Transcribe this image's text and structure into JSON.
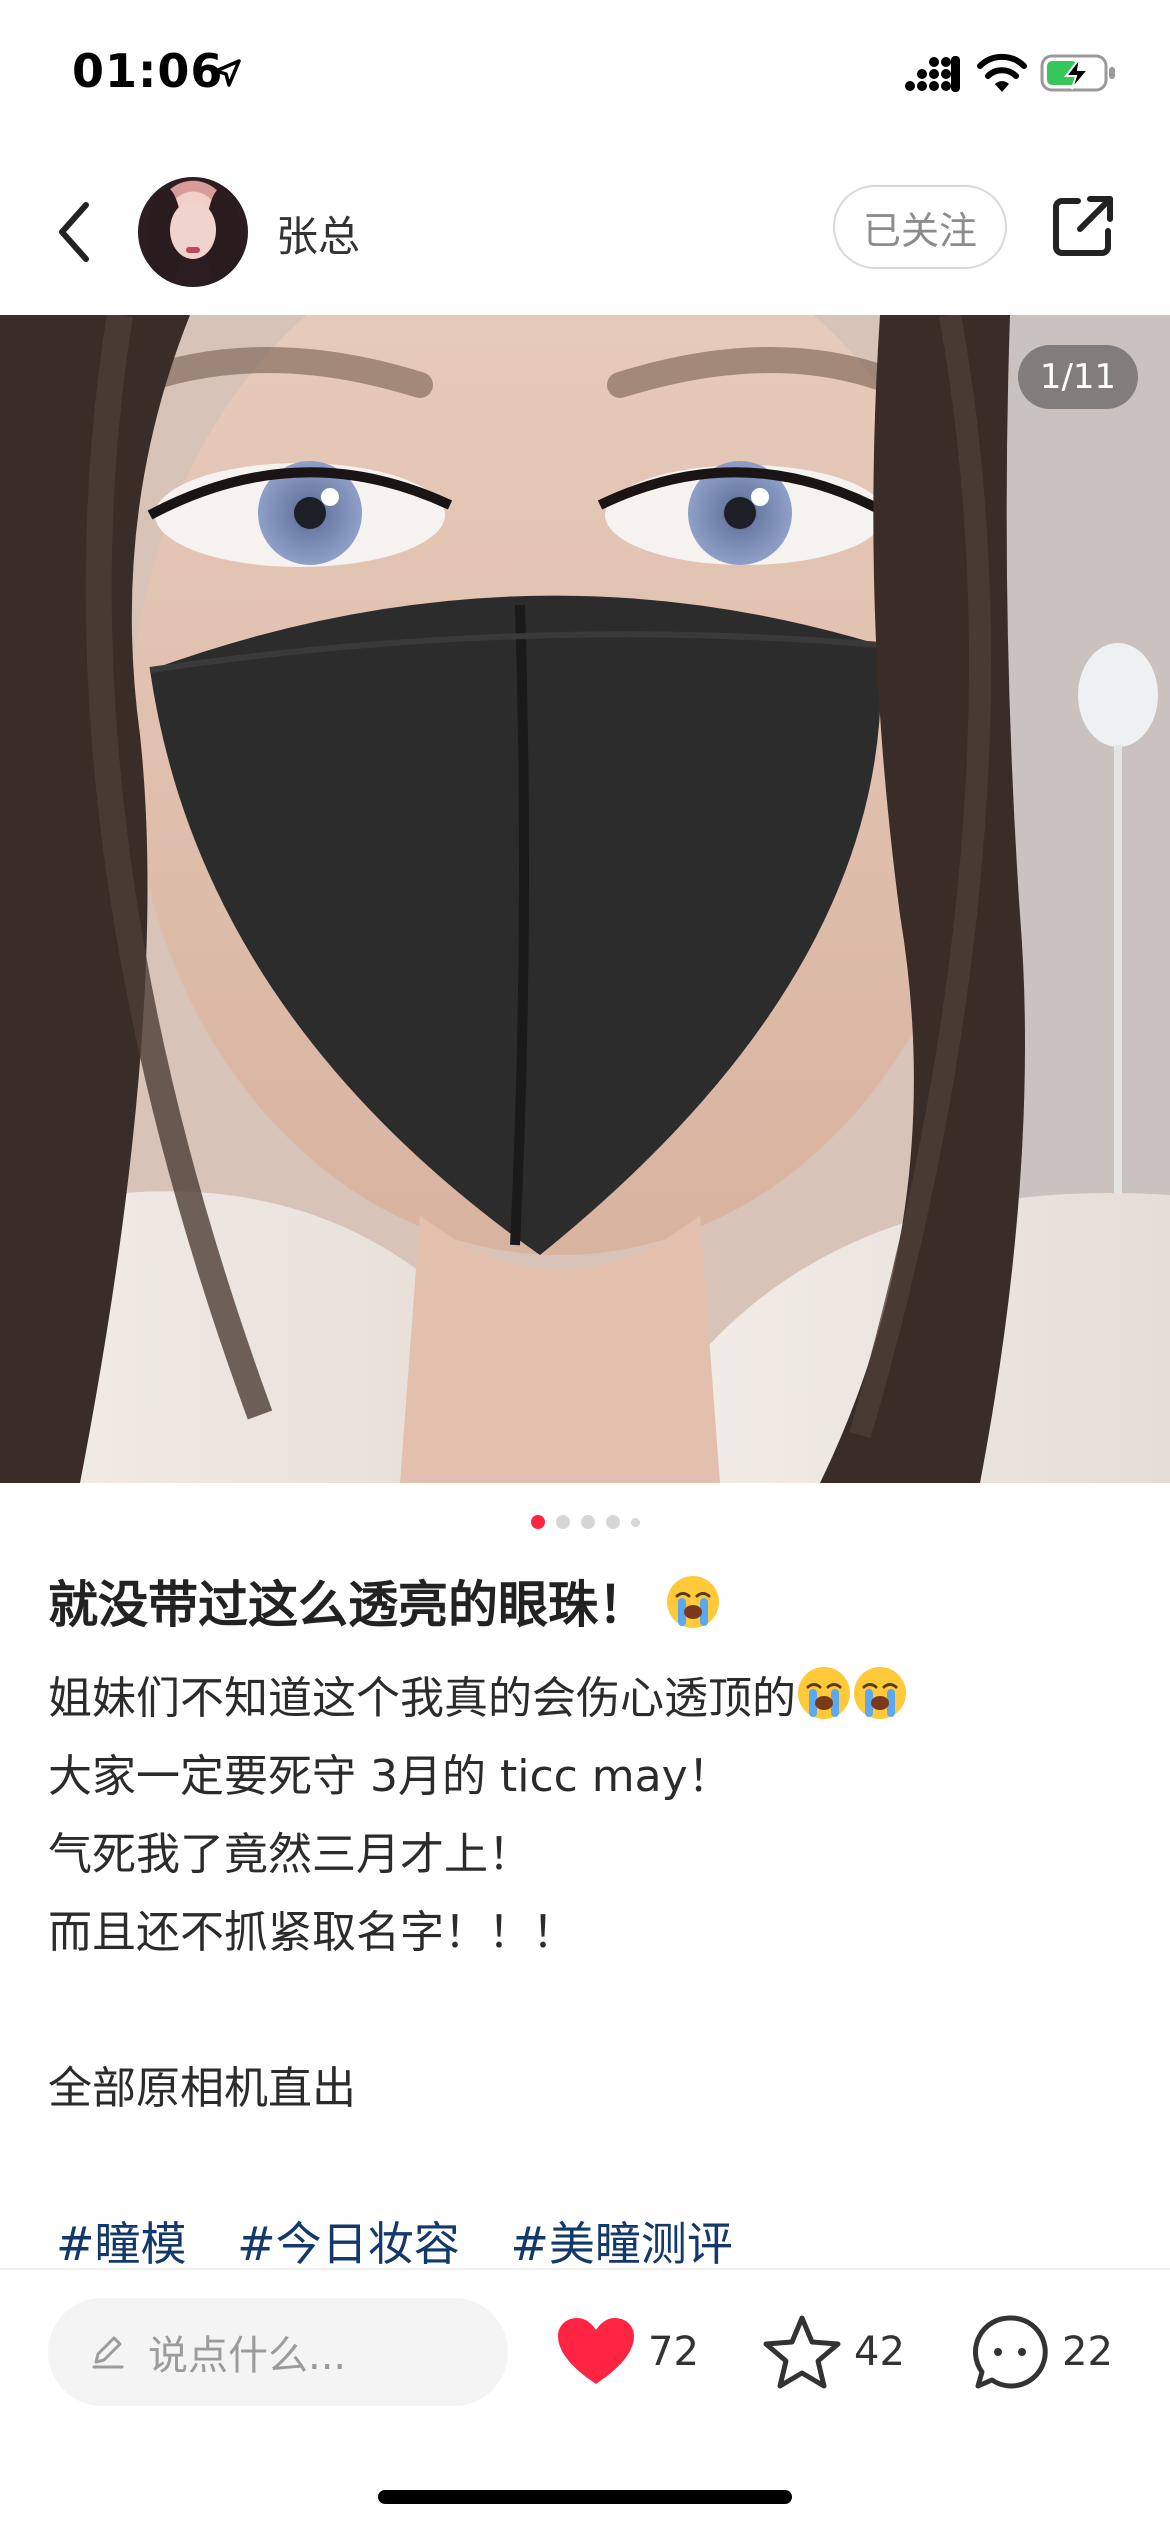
{
  "status_bar": {
    "time": "01:06",
    "icons": [
      "location-arrow-icon",
      "signal-icon",
      "wifi-icon",
      "battery-charging-icon"
    ]
  },
  "header": {
    "username": "张总",
    "follow_label": "已关注",
    "icons": [
      "back-icon",
      "share-icon"
    ]
  },
  "media": {
    "counter": "1/11",
    "pagination": {
      "total_dots": 5,
      "active_index": 0
    }
  },
  "post": {
    "title": "就没带过这么透亮的眼珠！",
    "title_emoji": "loudly-crying-emoji",
    "lines": [
      "姐妹们不知道这个我真的会伤心透顶的",
      "大家一定要死守 3月的 ticc may！",
      "气死我了竟然三月才上！",
      "而且还不抓紧取名字！！！",
      "",
      "全部原相机直出"
    ],
    "line1_emojis": [
      "loudly-crying-emoji",
      "loudly-crying-emoji"
    ],
    "tags": [
      "#瞳模",
      "#今日妆容",
      "#美瞳测评"
    ]
  },
  "bottom_bar": {
    "comment_placeholder": "说点什么...",
    "likes": "72",
    "favorites": "42",
    "comments": "22"
  },
  "colors": {
    "accent": "#ff2442",
    "tag": "#13386c"
  }
}
